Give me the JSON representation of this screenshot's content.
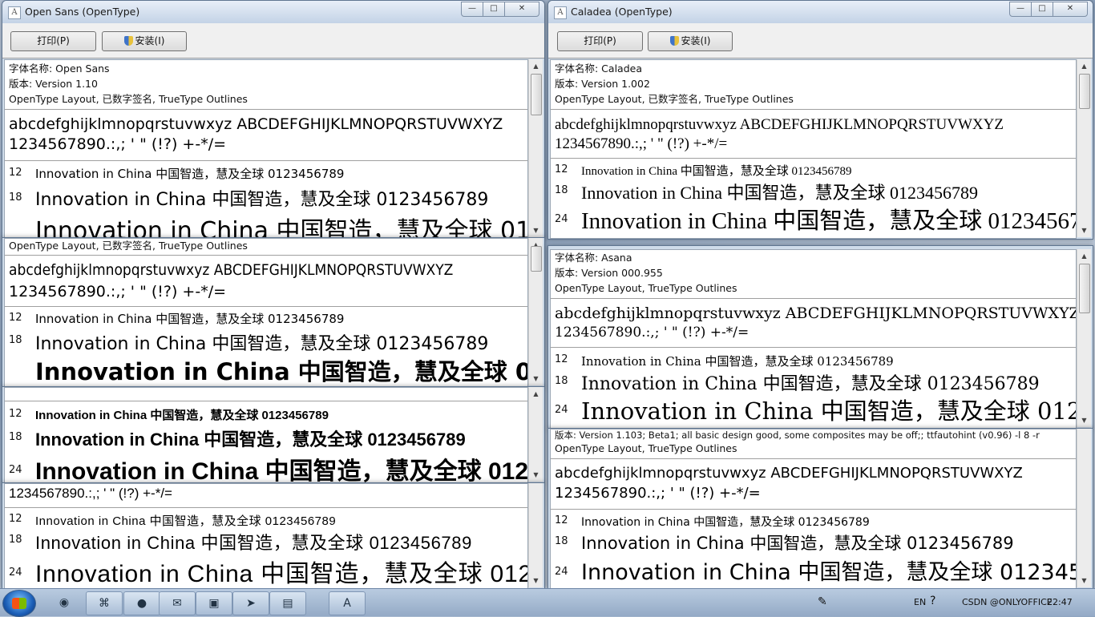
{
  "toolbar": {
    "print_label": "打印(P)",
    "install_label": "安装(I)"
  },
  "samples": {
    "alpha": "abcdefghijklmnopqrstuvwxyz ABCDEFGHIJKLMNOPQRSTUVWXYZ",
    "digits": "1234567890.:,; ' \" (!?) +-*/=",
    "sample_text": "Innovation in China 中国智造，慧及全球 0123456789",
    "size_12": "12",
    "size_18": "18",
    "size_24": "24"
  },
  "windows": {
    "open_sans": {
      "title": "Open Sans (OpenType)",
      "font_name": "字体名称: Open Sans",
      "version": "版本: Version 1.10",
      "layout": "OpenType Layout, 已数字签名, TrueType Outlines"
    },
    "caladea": {
      "title": "Caladea (OpenType)",
      "font_name": "字体名称: Caladea",
      "version": "版本: Version 1.002",
      "layout": "OpenType Layout, 已数字签名, TrueType Outlines"
    },
    "comic": {
      "layout": "OpenType Layout, 已数字签名, TrueType Outlines"
    },
    "asana": {
      "font_name": "字体名称: Asana",
      "version": "版本: Version 000.955",
      "layout": "OpenType Layout, TrueType Outlines"
    },
    "bottom_right": {
      "version": "版本: Version 1.103; Beta1; all basic design good, some composites may be off;; ttfautohint (v0.96) -l 8 -r",
      "layout": "OpenType Layout, TrueType Outlines"
    }
  },
  "controls": {
    "minimize": "—",
    "maximize": "□",
    "close": "✕"
  },
  "taskbar": {
    "lang": "EN",
    "clock": "22:47",
    "watermark": "CSDN @ONLYOFFICE"
  },
  "colors": {
    "window_frame": "#cfdcea",
    "taskbar": "#a9bdd6"
  }
}
